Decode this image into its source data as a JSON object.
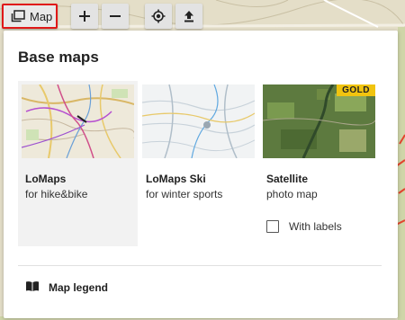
{
  "toolbar": {
    "map_label": "Map"
  },
  "panel": {
    "title": "Base maps",
    "maps": [
      {
        "name": "LoMaps",
        "description": "for hike&bike",
        "selected": true
      },
      {
        "name": "LoMaps Ski",
        "description": "for winter sports",
        "selected": false
      },
      {
        "name": "Satellite",
        "description": "photo map",
        "selected": false,
        "badge": "GOLD"
      }
    ],
    "with_labels": {
      "label": "With labels",
      "checked": false
    },
    "legend_label": "Map legend"
  },
  "colors": {
    "highlight_border": "#e01818",
    "gold_badge": "#f1c40f",
    "route_red": "#e2452e"
  }
}
